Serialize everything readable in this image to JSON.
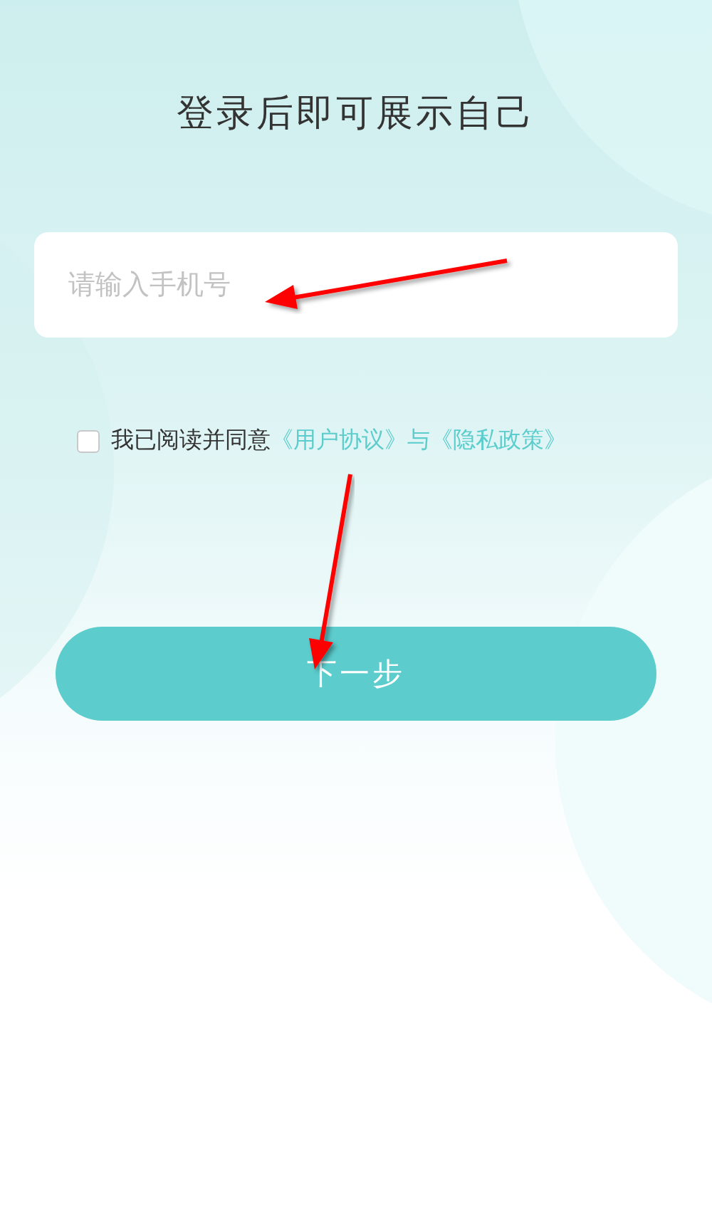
{
  "title": "登录后即可展示自己",
  "phone_field": {
    "placeholder": "请输入手机号"
  },
  "agreement": {
    "checked": false,
    "parts": [
      {
        "kind": "text",
        "text": "我已阅读并同意"
      },
      {
        "kind": "link",
        "text": "《用户协议》"
      },
      {
        "kind": "joiner",
        "text": "与"
      },
      {
        "kind": "link",
        "text": "《隐私政策》"
      }
    ]
  },
  "next_button": {
    "label": "下一步"
  }
}
